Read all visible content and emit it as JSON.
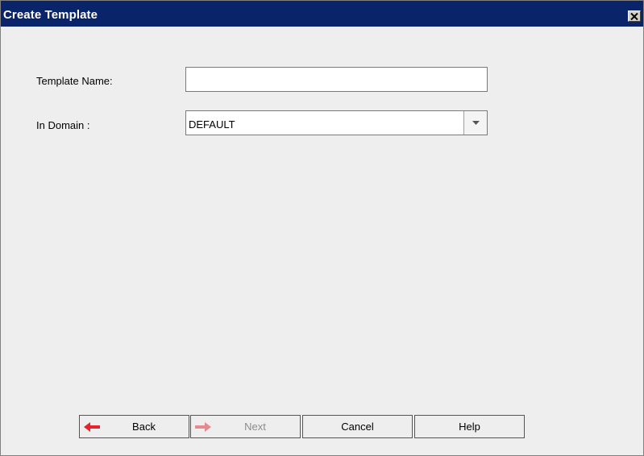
{
  "window": {
    "title": "Create Template",
    "close_icon": "close-icon"
  },
  "form": {
    "template_name_label": "Template Name:",
    "template_name_value": "",
    "domain_label": "In Domain :",
    "domain_value": "DEFAULT"
  },
  "buttons": {
    "back": "Back",
    "next": "Next",
    "cancel": "Cancel",
    "help": "Help"
  },
  "colors": {
    "titlebar": "#0a246a",
    "back_arrow": "#e8222a",
    "next_arrow_disabled": "#e58a8e"
  }
}
